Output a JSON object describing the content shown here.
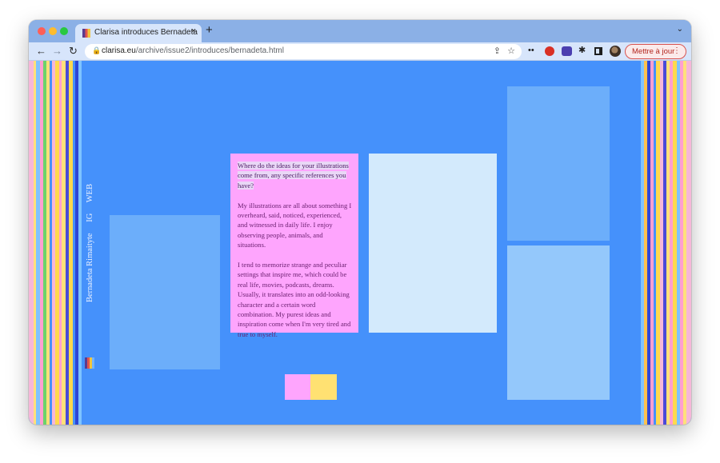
{
  "browser": {
    "tab_title": "Clarisa introduces Bernadeta",
    "tab_close": "×",
    "new_tab": "+",
    "tab_menu": "⌄",
    "nav_back": "←",
    "nav_forward": "→",
    "nav_reload": "↻",
    "url_host": "clarisa.eu",
    "url_path": "/archive/issue2/introduces/bernadeta.html",
    "update_label": "Mettre à jour",
    "update_kebab": "⋮",
    "ext_dots": "••",
    "ext_puzzle": "✱"
  },
  "page": {
    "side_links": [
      "Bernadeta Rimaityte",
      "IG",
      "WEB"
    ],
    "question": "Where do the ideas for your illustrations come from, any specific references you have?",
    "answer_1": "My illustrations are all about something I overheard, said, noticed, experienced, and witnessed in daily life. I enjoy observing people, animals, and situations.",
    "answer_2": "I tend to memorize strange and peculiar settings that inspire me, which could be real life, movies, podcasts, dreams. Usually, it translates into an odd-looking character and a certain word combination. My purest ideas and inspiration come when I'm very tired and true to myself."
  },
  "colors": {
    "page_bg": "#4591fb",
    "pink": "#fea5fd",
    "yellow": "#ffe172",
    "light_blue": "#d3eafc",
    "card_blue": "#6caefa",
    "card_blue_light": "#94c8fb"
  }
}
